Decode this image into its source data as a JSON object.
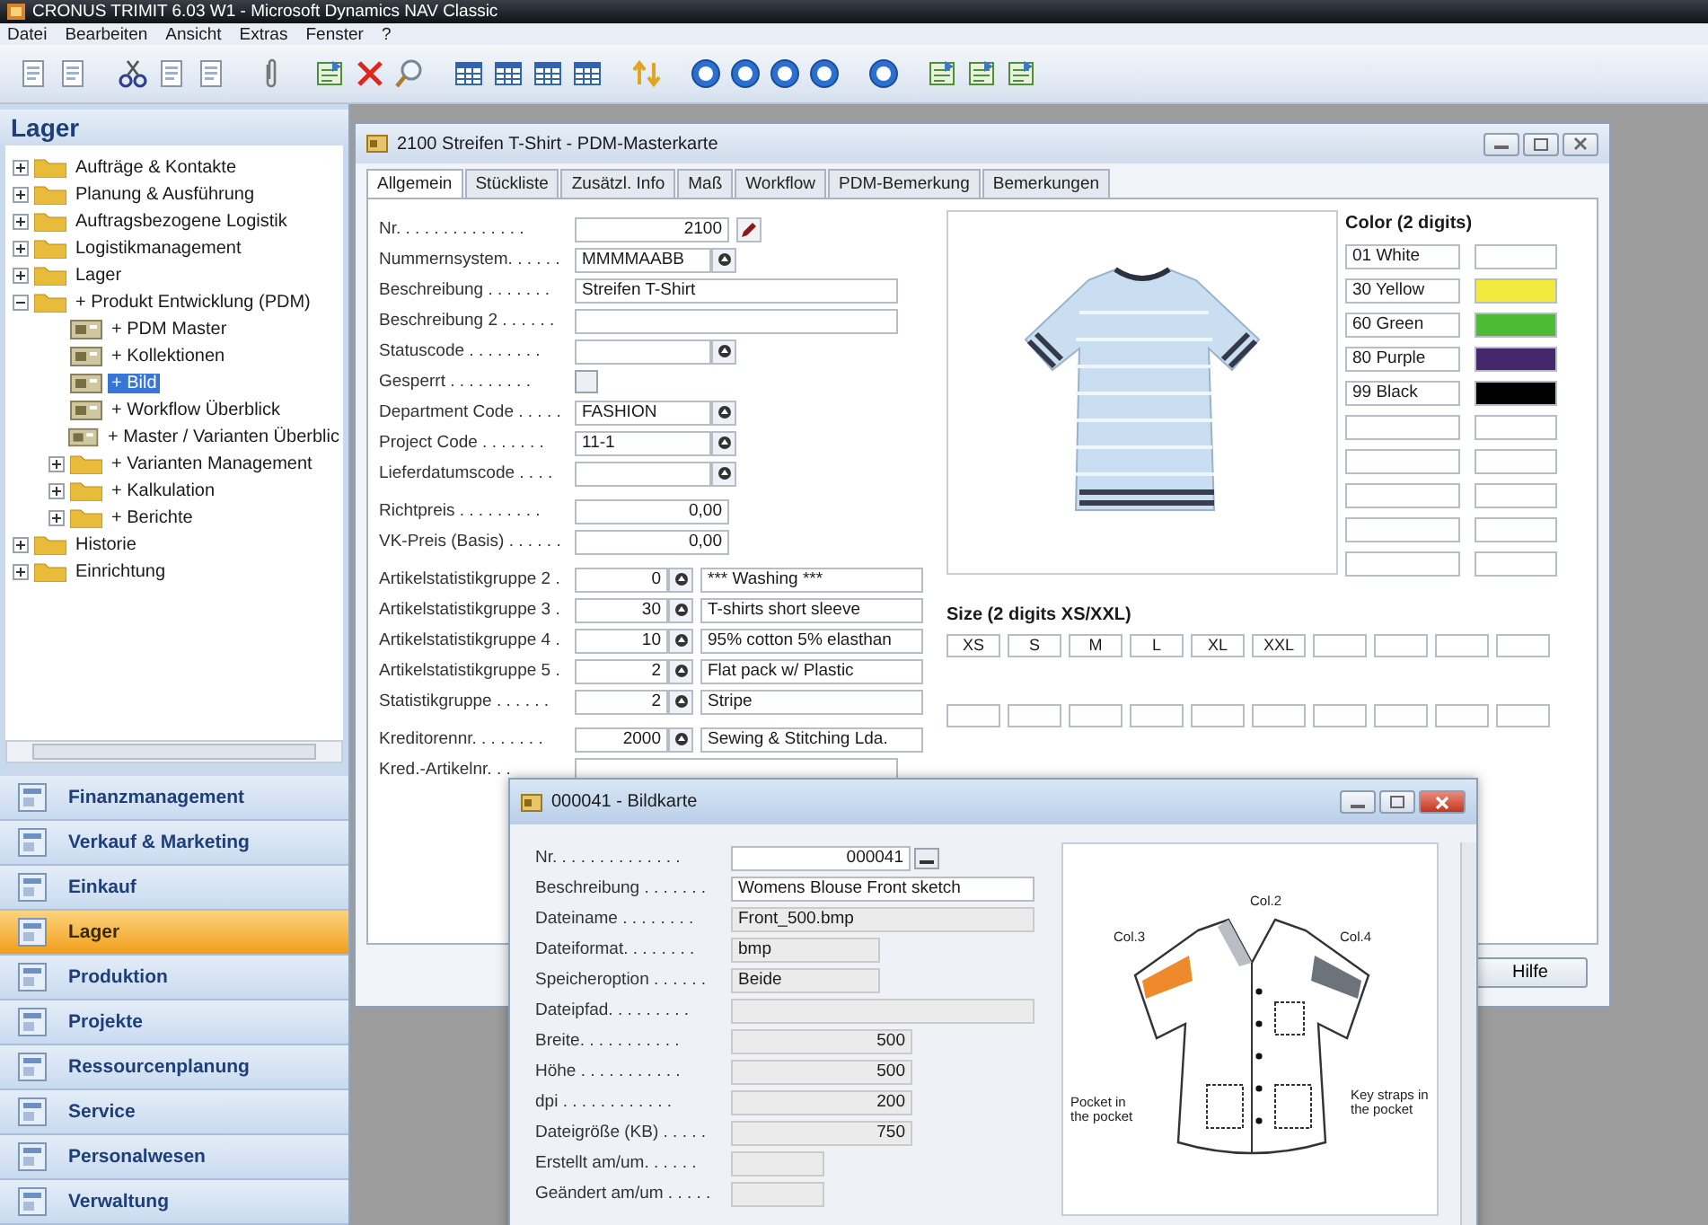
{
  "window": {
    "title": "CRONUS TRIMIT 6.03 W1 - Microsoft Dynamics NAV Classic"
  },
  "menu": [
    "Datei",
    "Bearbeiten",
    "Ansicht",
    "Extras",
    "Fenster",
    "?"
  ],
  "sidebar": {
    "title": "Lager",
    "tree": [
      {
        "label": "Aufträge & Kontakte",
        "kind": "folder",
        "expanded": false,
        "selected": false
      },
      {
        "label": "Planung & Ausführung",
        "kind": "folder",
        "expanded": false,
        "selected": false
      },
      {
        "label": "Auftragsbezogene Logistik",
        "kind": "folder",
        "expanded": false,
        "selected": false
      },
      {
        "label": "Logistikmanagement",
        "kind": "folder",
        "expanded": false,
        "selected": false
      },
      {
        "label": "Lager",
        "kind": "folder",
        "expanded": false,
        "selected": false
      },
      {
        "label": "+ Produkt Entwicklung (PDM)",
        "kind": "folder",
        "expanded": true,
        "selected": false,
        "children": [
          {
            "label": "+ PDM Master",
            "kind": "form",
            "selected": false
          },
          {
            "label": "+ Kollektionen",
            "kind": "form",
            "selected": false
          },
          {
            "label": "+ Bild",
            "kind": "form",
            "selected": true
          },
          {
            "label": "+ Workflow Überblick",
            "kind": "form",
            "selected": false
          },
          {
            "label": "+ Master / Varianten Überblic",
            "kind": "form",
            "selected": false
          },
          {
            "label": "+ Varianten Management",
            "kind": "folder",
            "expanded": false,
            "selected": false
          },
          {
            "label": "+ Kalkulation",
            "kind": "folder",
            "expanded": false,
            "selected": false
          },
          {
            "label": "+ Berichte",
            "kind": "folder",
            "expanded": false,
            "selected": false
          }
        ]
      },
      {
        "label": "Historie",
        "kind": "folder",
        "expanded": false,
        "selected": false
      },
      {
        "label": "Einrichtung",
        "kind": "folder",
        "expanded": false,
        "selected": false
      }
    ],
    "nav": [
      {
        "label": "Finanzmanagement",
        "selected": false
      },
      {
        "label": "Verkauf & Marketing",
        "selected": false
      },
      {
        "label": "Einkauf",
        "selected": false
      },
      {
        "label": "Lager",
        "selected": true
      },
      {
        "label": "Produktion",
        "selected": false
      },
      {
        "label": "Projekte",
        "selected": false
      },
      {
        "label": "Ressourcenplanung",
        "selected": false
      },
      {
        "label": "Service",
        "selected": false
      },
      {
        "label": "Personalwesen",
        "selected": false
      },
      {
        "label": "Verwaltung",
        "selected": false
      }
    ]
  },
  "card": {
    "title": "2100 Streifen T-Shirt - PDM-Masterkarte",
    "tabs": [
      {
        "label": "Allgemein",
        "selected": true
      },
      {
        "label": "Stückliste",
        "selected": false
      },
      {
        "label": "Zusätzl. Info",
        "selected": false
      },
      {
        "label": "Maß",
        "selected": false
      },
      {
        "label": "Workflow",
        "selected": false
      },
      {
        "label": "PDM-Bemerkung",
        "selected": false
      },
      {
        "label": "Bemerkungen",
        "selected": false
      }
    ],
    "field_groups": [
      [
        {
          "label": "Nr. . . . . . . . . . . . . .",
          "kind": "key_edit",
          "value": "2100"
        },
        {
          "label": "Nummernsystem. . . . . .",
          "kind": "lookup",
          "value": "MMMMAABB"
        },
        {
          "label": "Beschreibung . . . . . . .",
          "kind": "text",
          "value": "Streifen T-Shirt"
        },
        {
          "label": "Beschreibung 2 . . . . . .",
          "kind": "text"
        },
        {
          "label": "Statuscode . . . . . . . .",
          "kind": "lookup"
        },
        {
          "label": "Gesperrt . . . . . . . . .",
          "kind": "checkbox",
          "checked": false
        },
        {
          "label": "Department Code . . . . .",
          "kind": "lookup",
          "value": "FASHION"
        },
        {
          "label": "Project Code . . . . . . .",
          "kind": "lookup",
          "value": "11-1"
        },
        {
          "label": "Lieferdatumscode . . . .",
          "kind": "lookup"
        }
      ],
      [
        {
          "label": "Richtpreis . . . . . . . . .",
          "kind": "number",
          "value": "0,00"
        },
        {
          "label": "VK-Preis (Basis) . . . . . .",
          "kind": "number",
          "value": "0,00"
        }
      ],
      [
        {
          "label": "Artikelstatistikgruppe 2 .",
          "kind": "code",
          "value": "0",
          "description": "*** Washing ***"
        },
        {
          "label": "Artikelstatistikgruppe 3 .",
          "kind": "code",
          "value": "30",
          "description": "T-shirts short sleeve"
        },
        {
          "label": "Artikelstatistikgruppe 4 .",
          "kind": "code",
          "value": "10",
          "description": "95% cotton 5% elasthan"
        },
        {
          "label": "Artikelstatistikgruppe 5 .",
          "kind": "code",
          "value": "2",
          "description": "Flat pack w/ Plastic"
        },
        {
          "label": "Statistikgruppe . . . . . .",
          "kind": "code",
          "value": "2",
          "description": "Stripe"
        }
      ],
      [
        {
          "label": "Kreditorennr. . . . . . . .",
          "kind": "code",
          "value": "2000",
          "description": "Sewing & Stitching Lda."
        },
        {
          "label": "Kred.-Artikelnr. . .",
          "kind": "text"
        }
      ]
    ],
    "color_title": "Color (2 digits)",
    "colors": [
      {
        "label": "01 White",
        "color": "#ffffff"
      },
      {
        "label": "30 Yellow",
        "color": "#f2ea3c"
      },
      {
        "label": "60 Green",
        "color": "#4dbb35"
      },
      {
        "label": "80 Purple",
        "color": "#45286b"
      },
      {
        "label": "99 Black",
        "color": "#000000"
      }
    ],
    "size_title": "Size (2 digits XS/XXL)",
    "sizes": [
      "XS",
      "S",
      "M",
      "L",
      "XL",
      "XXL"
    ],
    "buttons": [
      "Hilfe"
    ]
  },
  "popup": {
    "title": "000041 - Bildkarte",
    "fields": [
      {
        "label": "Nr. . . . . . . . . . . . . .",
        "kind": "key",
        "value": "000041"
      },
      {
        "label": "Beschreibung . . . . . . .",
        "kind": "text",
        "value": "Womens Blouse Front sketch"
      },
      {
        "label": "Dateiname . . . . . . . .",
        "kind": "wide",
        "value": "Front_500.bmp"
      },
      {
        "label": "Dateiformat. . . . . . . .",
        "kind": "short",
        "value": "bmp"
      },
      {
        "label": "Speicheroption . . . . . .",
        "kind": "short",
        "value": "Beide"
      },
      {
        "label": "Dateipfad. . . . . . . . .",
        "kind": "wide"
      },
      {
        "label": "Breite. . . . . . . . . . .",
        "kind": "number",
        "value": "500"
      },
      {
        "label": "Höhe . . . . . . . . . . .",
        "kind": "number",
        "value": "500"
      },
      {
        "label": "dpi . . . . . . . . . . . .",
        "kind": "number",
        "value": "200"
      },
      {
        "label": "Dateigröße (KB) . . . . .",
        "kind": "number",
        "value": "750"
      },
      {
        "label": "Erstellt am/um. . . . . .",
        "kind": "date"
      },
      {
        "label": "Geändert am/um . . . . .",
        "kind": "date"
      }
    ],
    "sketch_labels": [
      {
        "kind": "col2",
        "text": "Col.2"
      },
      {
        "kind": "col3",
        "text": "Col.3"
      },
      {
        "kind": "col4",
        "text": "Col.4"
      },
      {
        "kind": "left",
        "text": "Pocket in the pocket"
      },
      {
        "kind": "right",
        "text": "Key straps in the pocket"
      }
    ]
  }
}
